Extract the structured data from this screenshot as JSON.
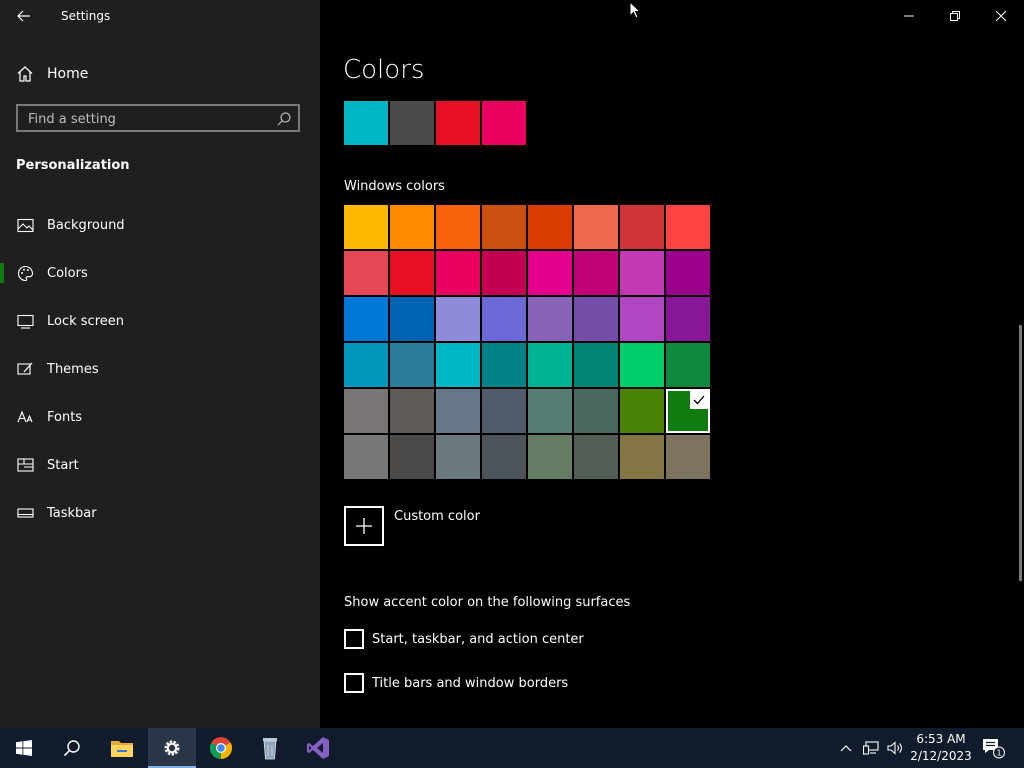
{
  "window": {
    "title": "Settings"
  },
  "sidebar": {
    "home_label": "Home",
    "search_placeholder": "Find a setting",
    "section": "Personalization",
    "items": [
      {
        "label": "Background",
        "icon": "image-icon",
        "active": false
      },
      {
        "label": "Colors",
        "icon": "palette-icon",
        "active": true
      },
      {
        "label": "Lock screen",
        "icon": "lock-screen-icon",
        "active": false
      },
      {
        "label": "Themes",
        "icon": "brush-icon",
        "active": false
      },
      {
        "label": "Fonts",
        "icon": "font-icon",
        "active": false
      },
      {
        "label": "Start",
        "icon": "start-layout-icon",
        "active": false
      },
      {
        "label": "Taskbar",
        "icon": "taskbar-icon",
        "active": false
      }
    ]
  },
  "main": {
    "title": "Colors",
    "recent_colors": [
      "#00b7c3",
      "#4c4a48",
      "#e81123",
      "#ea005e"
    ],
    "windows_colors_title": "Windows colors",
    "windows_colors": [
      "#ffb900",
      "#ff8c00",
      "#f7630c",
      "#ca5010",
      "#da3b01",
      "#ef6950",
      "#d13438",
      "#ff4343",
      "#e74856",
      "#e81123",
      "#ea005e",
      "#c30052",
      "#e3008c",
      "#bf0077",
      "#c239b3",
      "#9a0089",
      "#0078d7",
      "#0063b1",
      "#8e8cd8",
      "#6b69d6",
      "#8764b8",
      "#744da9",
      "#b146c2",
      "#881798",
      "#0099bc",
      "#2d7d9a",
      "#00b7c3",
      "#038387",
      "#00b294",
      "#018574",
      "#00cc6a",
      "#10893e",
      "#7a7574",
      "#5d5a58",
      "#68768a",
      "#515c6b",
      "#567c73",
      "#486860",
      "#498205",
      "#107c10",
      "#767676",
      "#4c4a48",
      "#69797e",
      "#4a5459",
      "#647c64",
      "#525e54",
      "#847545",
      "#7e735f"
    ],
    "selected_color_index": 39,
    "custom_color_label": "Custom color",
    "surfaces_title": "Show accent color on the following surfaces",
    "surfaces": [
      {
        "label": "Start, taskbar, and action center",
        "checked": false
      },
      {
        "label": "Title bars and window borders",
        "checked": false
      }
    ]
  },
  "taskbar": {
    "time": "6:53 AM",
    "date": "2/12/2023",
    "notification_count": "1",
    "apps": [
      "start-icon",
      "search-icon",
      "file-explorer-icon",
      "settings-icon",
      "chrome-icon",
      "recycle-bin-icon",
      "visual-studio-icon"
    ],
    "active_app": "settings-icon"
  },
  "colors": {
    "accent": "#107c10",
    "taskbar_bg": "#101c2c",
    "sidebar_bg": "#1f1f1f"
  }
}
